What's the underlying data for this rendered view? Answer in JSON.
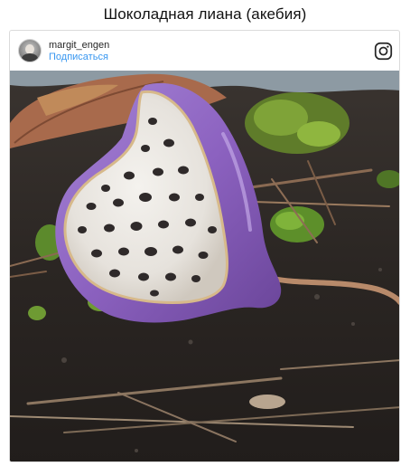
{
  "page": {
    "title": "Шоколадная лиана (акебия)"
  },
  "post": {
    "username": "margit_engen",
    "follow_label": "Подписаться",
    "avatar_icon": "user-avatar",
    "platform_icon": "instagram-logo-icon",
    "image_subject": "photo"
  },
  "colors": {
    "link": "#3897f0",
    "card_border": "#dbdbdb",
    "fruit_skin": "#8f63c0"
  }
}
